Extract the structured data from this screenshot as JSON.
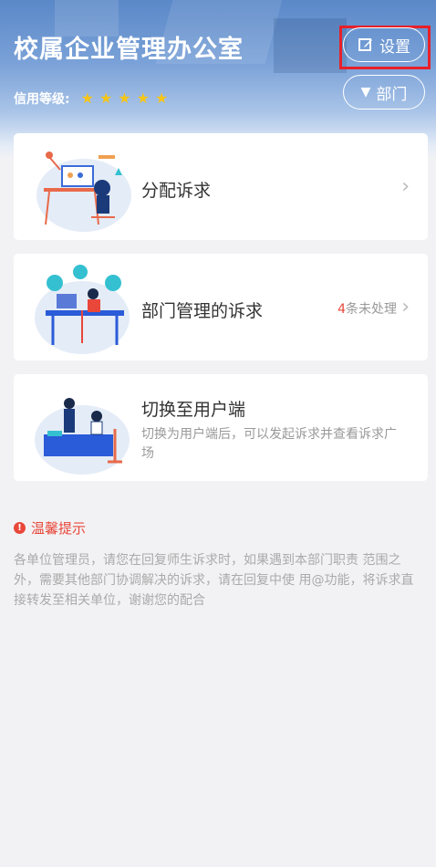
{
  "header": {
    "title": "校属企业管理办公室",
    "credit_label": "信用等级:",
    "credit_stars": 5,
    "settings_label": "设置",
    "dept_label": "部门"
  },
  "cards": [
    {
      "label": "分配诉求"
    },
    {
      "label": "部门管理的诉求",
      "badge_count": "4",
      "badge_text": "条未处理"
    },
    {
      "label": "切换至用户端",
      "subtitle": "切换为用户端后，可以发起诉求并查看诉求广场"
    }
  ],
  "tip": {
    "title": "温馨提示",
    "body": "各单位管理员，请您在回复师生诉求时，如果遇到本部门职责 范围之外，需要其他部门协调解决的诉求，请在回复中使 用@功能，将诉求直接转发至相关单位，谢谢您的配合"
  },
  "colors": {
    "accent_red": "#e8473a",
    "star": "#f5c518",
    "header_blue": "#5a88c8"
  },
  "icons": [
    "edit-icon",
    "triangle-down-icon",
    "star-icon",
    "chevron-right-icon",
    "info-icon"
  ]
}
